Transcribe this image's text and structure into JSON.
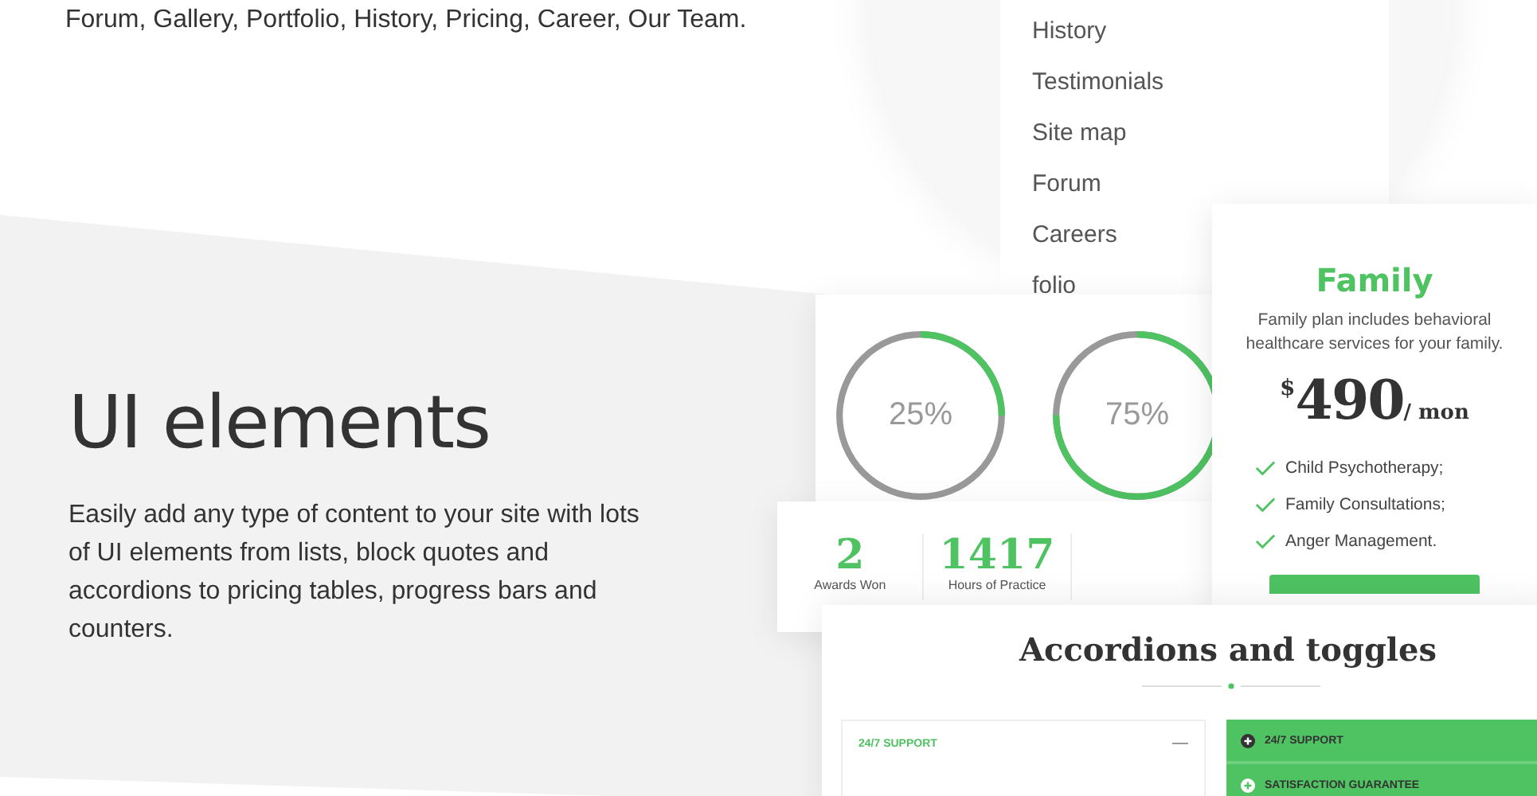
{
  "intro_text": "Forum, Gallery, Portfolio, History, Pricing, Career, Our Team.",
  "section": {
    "title": "UI elements",
    "description": "Easily add any type of content to your site with lots of UI elements from lists, block quotes and accordions to pricing tables, progress bars and counters."
  },
  "menu": {
    "items": [
      "History",
      "Testimonials",
      "Site map",
      "Forum",
      "Careers",
      "folio"
    ]
  },
  "progress_circles": [
    {
      "label": "25%",
      "level": 0.25
    },
    {
      "label": "75%",
      "level": 0.75
    }
  ],
  "counters": [
    {
      "value": "2",
      "label": "Awards Won"
    },
    {
      "value": "1417",
      "label": "Hours of Practice"
    }
  ],
  "pricing": {
    "title": "Family",
    "description": "Family plan includes behavioral healthcare services for your family.",
    "currency": "$",
    "price": "490",
    "period": "/ mon",
    "features": [
      "Child Psychotherapy;",
      "Family Consultations;",
      "Anger Management."
    ]
  },
  "accordions": {
    "title": "Accordions and toggles",
    "left": [
      {
        "label": "24/7 SUPPORT",
        "expanded": true
      }
    ],
    "right": [
      {
        "label": "24/7 SUPPORT",
        "expanded": false
      },
      {
        "label": "SATISFACTION GUARANTEE",
        "expanded": false
      }
    ]
  }
}
